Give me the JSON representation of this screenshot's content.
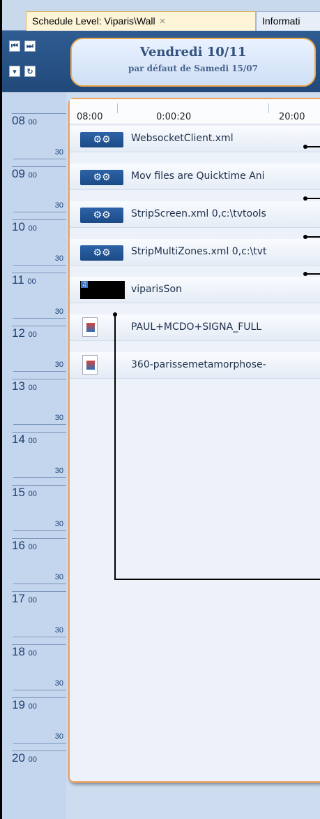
{
  "tabs": [
    {
      "label": "Schedule Level: Viparis\\Wall",
      "close": "×"
    },
    {
      "label": "Informati"
    }
  ],
  "header": {
    "date": "Vendredi 10/11",
    "subtitle": "par défaut de Samedi 15/07"
  },
  "ruler": {
    "t0": "08:00",
    "t1": "0:00:20",
    "t2": "20:00"
  },
  "time_slots": [
    {
      "hour": "08",
      "min": "00",
      "half": "30"
    },
    {
      "hour": "09",
      "min": "00",
      "half": "30"
    },
    {
      "hour": "10",
      "min": "00",
      "half": "30"
    },
    {
      "hour": "11",
      "min": "00",
      "half": "30"
    },
    {
      "hour": "12",
      "min": "00",
      "half": "30"
    },
    {
      "hour": "13",
      "min": "00",
      "half": "30"
    },
    {
      "hour": "14",
      "min": "00",
      "half": "30"
    },
    {
      "hour": "15",
      "min": "00",
      "half": "30"
    },
    {
      "hour": "16",
      "min": "00",
      "half": "30"
    },
    {
      "hour": "17",
      "min": "00",
      "half": "30"
    },
    {
      "hour": "18",
      "min": "00",
      "half": "30"
    },
    {
      "hour": "19",
      "min": "00",
      "half": "30"
    },
    {
      "hour": "20",
      "min": "00",
      "half": ""
    }
  ],
  "items": [
    {
      "type": "script",
      "icon": "gears-icon",
      "label": "WebsocketClient.xml"
    },
    {
      "type": "script",
      "icon": "gears-icon",
      "label": "Mov files are Quicktime Ani"
    },
    {
      "type": "script",
      "icon": "gears-icon",
      "label": "StripScreen.xml 0,c:\\tvtools"
    },
    {
      "type": "script",
      "icon": "gears-icon",
      "label": "StripMultiZones.xml 0,c:\\tvt"
    },
    {
      "type": "audio",
      "icon": "audio-icon",
      "label": "viparisSon"
    },
    {
      "type": "video",
      "icon": "video-file-icon",
      "label": "PAUL+MCDO+SIGNA_FULL"
    },
    {
      "type": "video",
      "icon": "video-file-icon",
      "label": "360-parissemetamorphose-"
    }
  ],
  "colors": {
    "accent": "#f0a057",
    "header_bg": "#2f5c92",
    "panel_bg": "#edf2fa"
  }
}
